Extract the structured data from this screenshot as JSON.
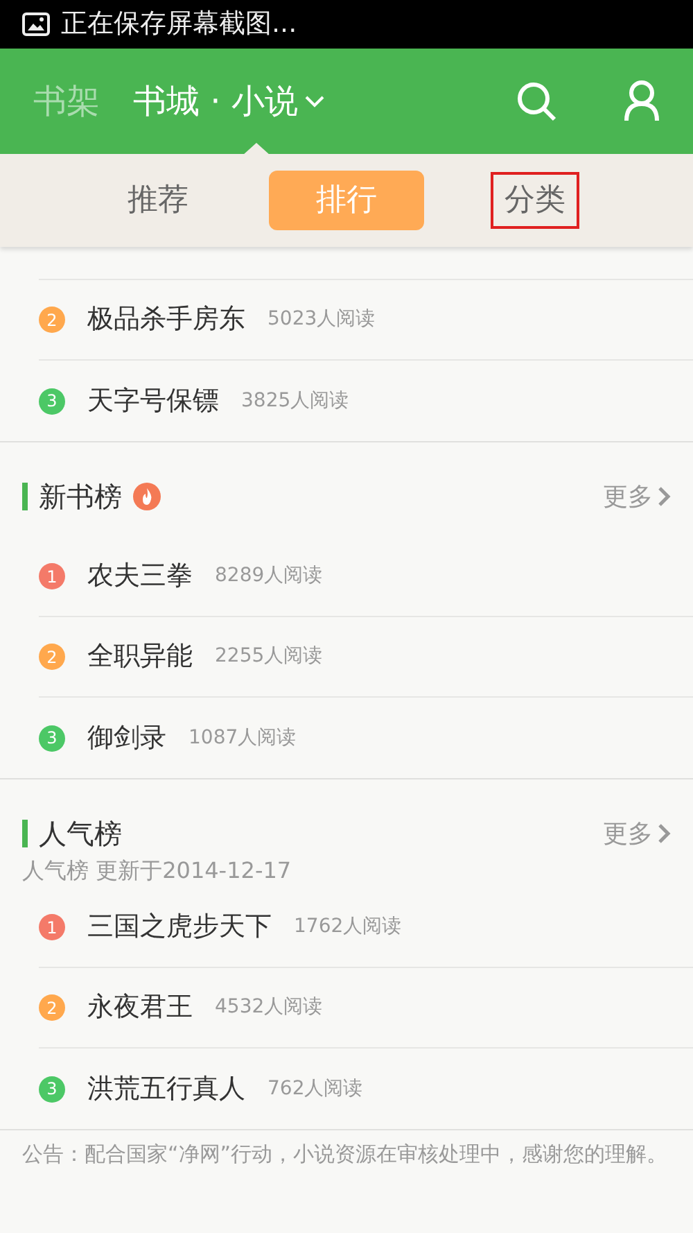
{
  "status_bar": {
    "notification": "正在保存屏幕截图..."
  },
  "header": {
    "shelf_label": "书架",
    "title": "书城 · 小说"
  },
  "tabs": [
    {
      "label": "推荐",
      "selected": false,
      "outlined": false
    },
    {
      "label": "排行",
      "selected": true,
      "outlined": false
    },
    {
      "label": "分类",
      "selected": false,
      "outlined": true
    }
  ],
  "sections": [
    {
      "items": [
        {
          "rank": "2",
          "name": "极品杀手房东",
          "reads": "5023人阅读"
        },
        {
          "rank": "3",
          "name": "天字号保镖",
          "reads": "3825人阅读"
        }
      ]
    },
    {
      "title": "新书榜",
      "hot": true,
      "more": "更多",
      "items": [
        {
          "rank": "1",
          "name": "农夫三拳",
          "reads": "8289人阅读"
        },
        {
          "rank": "2",
          "name": "全职异能",
          "reads": "2255人阅读"
        },
        {
          "rank": "3",
          "name": "御剑录",
          "reads": "1087人阅读"
        }
      ]
    },
    {
      "title": "人气榜",
      "hot": false,
      "more": "更多",
      "subtitle": "人气榜 更新于2014-12-17",
      "items": [
        {
          "rank": "1",
          "name": "三国之虎步天下",
          "reads": "1762人阅读"
        },
        {
          "rank": "2",
          "name": "永夜君王",
          "reads": "4532人阅读"
        },
        {
          "rank": "3",
          "name": "洪荒五行真人",
          "reads": "762人阅读"
        }
      ]
    }
  ],
  "notice": "公告：配合国家“净网”行动，小说资源在审核处理中，感谢您的理解。"
}
